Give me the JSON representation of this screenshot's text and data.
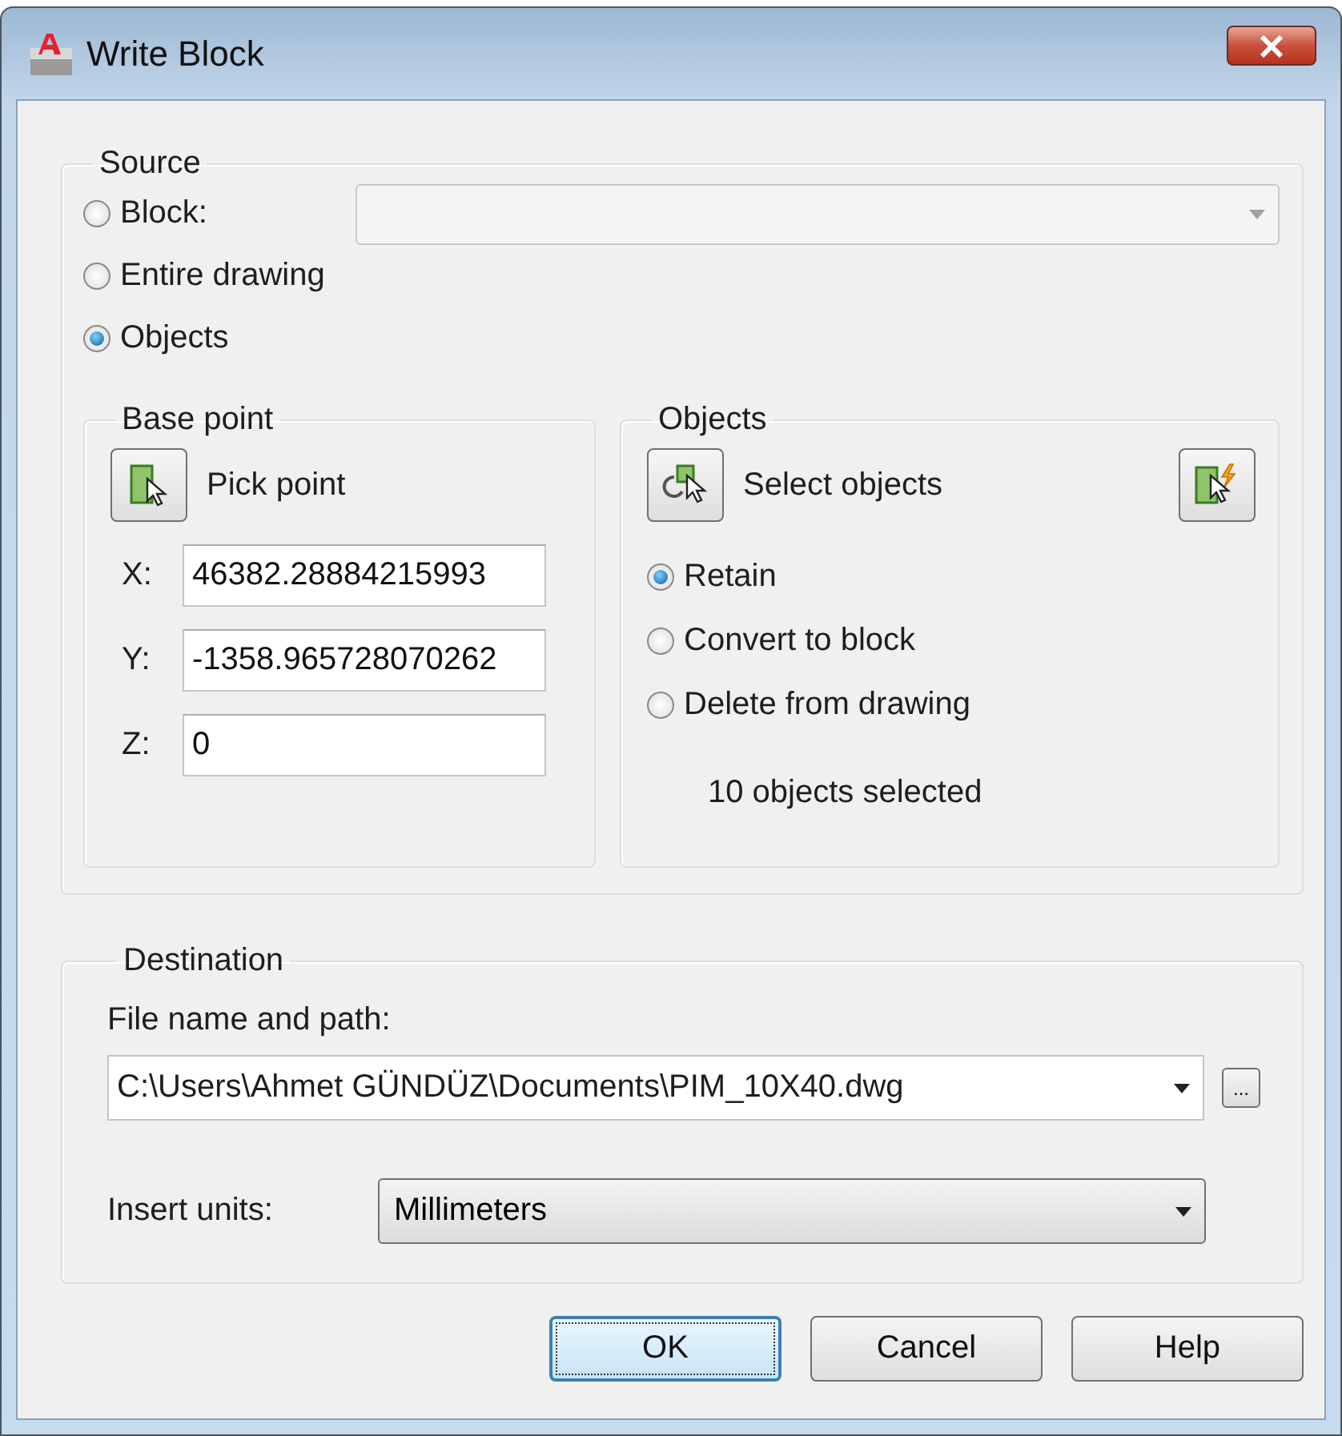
{
  "window": {
    "title": "Write Block"
  },
  "source": {
    "title": "Source",
    "block_combo": {
      "disabled": true
    },
    "options": [
      {
        "label": "Block:",
        "selected": false
      },
      {
        "label": "Entire drawing",
        "selected": false
      },
      {
        "label": "Objects",
        "selected": true
      }
    ]
  },
  "base_point": {
    "title": "Base point",
    "pick_button": {
      "label": "Pick point"
    },
    "coords": [
      {
        "label": "X:",
        "value": "46382.28884215993"
      },
      {
        "label": "Y:",
        "value": "-1358.965728070262"
      },
      {
        "label": "Z:",
        "value": "0"
      }
    ]
  },
  "objects": {
    "title": "Objects",
    "select_button": {
      "label": "Select objects"
    },
    "options": [
      {
        "label": "Retain",
        "selected": true
      },
      {
        "label": "Convert to block",
        "selected": false
      },
      {
        "label": "Delete from drawing",
        "selected": false
      }
    ],
    "status": "10 objects selected"
  },
  "destination": {
    "title": "Destination",
    "file_label": {
      "label": "File name and path:"
    },
    "file_path": "C:\\Users\\Ahmet GÜNDÜZ\\Documents\\PIM_10X40.dwg",
    "browse_button": "...",
    "units_label": {
      "label": "Insert units:"
    },
    "units": "Millimeters"
  },
  "buttons": [
    {
      "label": "OK",
      "default": true
    },
    {
      "label": "Cancel",
      "default": false
    },
    {
      "label": "Help",
      "default": false
    }
  ]
}
